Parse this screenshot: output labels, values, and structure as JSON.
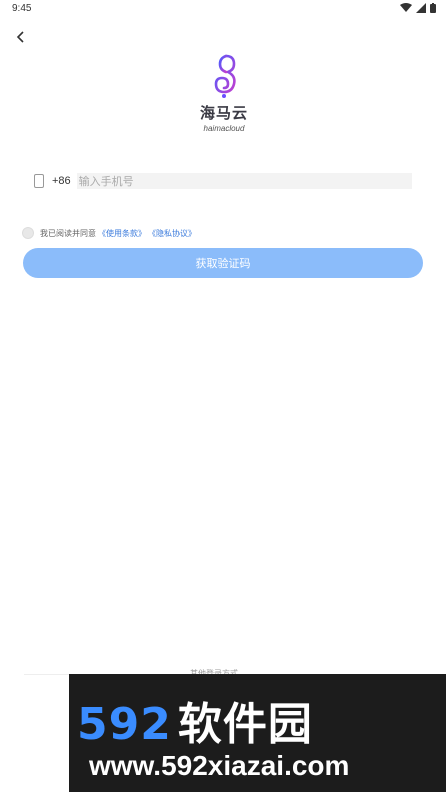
{
  "status_bar": {
    "time": "9:45"
  },
  "logo": {
    "brand_cn": "海马云",
    "brand_en": "haimacloud"
  },
  "login": {
    "country_code": "+86",
    "phone_placeholder": "输入手机号",
    "agreement_prefix": "我已阅读并同意",
    "terms_link": "《使用条款》",
    "privacy_link": "《隐私协议》",
    "get_code_label": "获取验证码"
  },
  "footer": {
    "partial_text": "其他登录方式"
  },
  "watermark": {
    "brand": "592",
    "brand_cn": "软件园",
    "url": "www.592xiazai.com"
  },
  "colors": {
    "accent": "#8bbcfa",
    "link": "#3b7bdc"
  },
  "icons": [
    "back-icon",
    "wifi-icon",
    "signal-icon",
    "battery-icon",
    "phone-icon",
    "seahorse-logo-icon"
  ]
}
